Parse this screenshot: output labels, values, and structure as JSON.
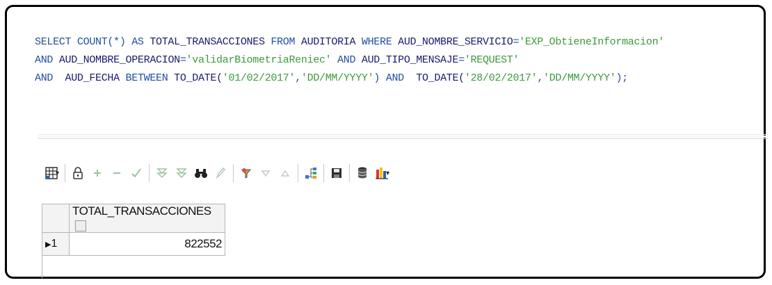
{
  "sql": {
    "line1": {
      "select": "SELECT COUNT(*) AS ",
      "alias": "TOTAL_TRANSACCIONES",
      "from": " FROM ",
      "table": "AUDITORIA",
      "where": " WHERE ",
      "col1": "AUD_NOMBRE_SERVICIO",
      "eq1": "=",
      "val1": "'EXP_ObtieneInformacion'"
    },
    "line2": {
      "and1": "AND ",
      "col2": "AUD_NOMBRE_OPERACION",
      "eq2": "=",
      "val2": "'validarBiometriaReniec'",
      "and2": " AND ",
      "col3": "AUD_TIPO_MENSAJE",
      "eq3": "=",
      "val3": "'REQUEST'"
    },
    "line3": {
      "and3": "AND  ",
      "col4": "AUD_FECHA",
      "between": " BETWEEN ",
      "todate1": "TO_DATE(",
      "date1": "'01/02/2017'",
      "comma1": ",",
      "fmt1": "'DD/MM/YYYY'",
      "close1": ")",
      "and4": " AND  ",
      "todate2": "TO_DATE(",
      "date2": "'28/02/2017'",
      "comma2": ",",
      "fmt2": "'DD/MM/YYYY'",
      "close2": ");"
    }
  },
  "toolbar": {
    "icons": {
      "grid": "grid-icon",
      "lock": "lock-icon",
      "add": "plus",
      "remove": "minus",
      "post": "check-icon",
      "find": "binoculars-icon",
      "save": "floppy-icon"
    }
  },
  "result_grid": {
    "columns": [
      "TOTAL_TRANSACCIONES"
    ],
    "rows": [
      {
        "row_number": "1",
        "values": [
          "822552"
        ]
      }
    ]
  }
}
